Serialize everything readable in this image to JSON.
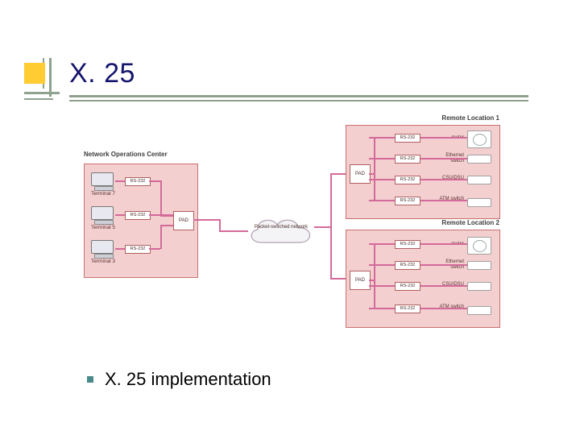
{
  "title": "X. 25",
  "bullet": "X. 25 implementation",
  "noc": {
    "title": "Network Operations Center",
    "iface": "RS-232",
    "terminals": [
      "Terminal 7",
      "Terminal 5",
      "Terminal 3"
    ],
    "pad": "PAD"
  },
  "cloud": {
    "label": "Packet-switched\nnetwork"
  },
  "remote1": {
    "title": "Remote Location 1",
    "pad": "PAD",
    "ifaces": [
      "RS-232",
      "RS-232",
      "RS-232",
      "RS-232"
    ],
    "devs": [
      "router",
      "Ethernet switch",
      "CSU/DSU",
      "ATM switch"
    ]
  },
  "remote2": {
    "title": "Remote Location 2",
    "pad": "PAD",
    "ifaces": [
      "RS-232",
      "RS-232",
      "RS-232",
      "RS-232"
    ],
    "devs": [
      "router",
      "Ethernet switch",
      "CSU/DSU",
      "ATM switch"
    ]
  }
}
